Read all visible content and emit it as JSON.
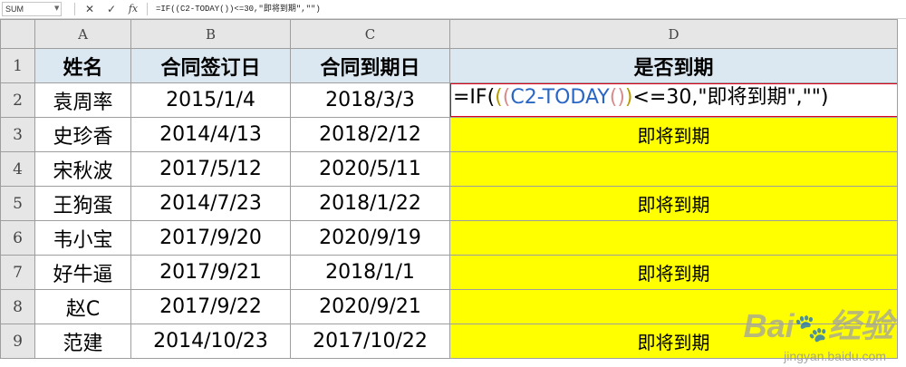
{
  "formula_bar": {
    "name_box": "SUM",
    "cancel_icon": "✕",
    "enter_icon": "✓",
    "fx_label": "fx",
    "formula": "=IF((C2-TODAY())<=30,\"即将到期\",\"\")"
  },
  "columns": [
    "A",
    "B",
    "C",
    "D"
  ],
  "rows": [
    "1",
    "2",
    "3",
    "4",
    "5",
    "6",
    "7",
    "8",
    "9"
  ],
  "headers": [
    "姓名",
    "合同签订日",
    "合同到期日",
    "是否到期"
  ],
  "data": [
    {
      "name": "袁周率",
      "sign": "2015/1/4",
      "due": "2018/3/3",
      "status": ""
    },
    {
      "name": "史珍香",
      "sign": "2014/4/13",
      "due": "2018/2/12",
      "status": "即将到期"
    },
    {
      "name": "宋秋波",
      "sign": "2017/5/12",
      "due": "2020/5/11",
      "status": ""
    },
    {
      "name": "王狗蛋",
      "sign": "2014/7/23",
      "due": "2018/1/22",
      "status": "即将到期"
    },
    {
      "name": "韦小宝",
      "sign": "2017/9/20",
      "due": "2020/9/19",
      "status": ""
    },
    {
      "name": "好牛逼",
      "sign": "2017/9/21",
      "due": "2018/1/1",
      "status": "即将到期"
    },
    {
      "name": "赵C",
      "sign": "2017/9/22",
      "due": "2020/9/21",
      "status": ""
    },
    {
      "name": "范建",
      "sign": "2014/10/23",
      "due": "2017/10/22",
      "status": "即将到期"
    }
  ],
  "edit_cell": {
    "p1": "=IF(",
    "paren_open_outer": "(",
    "paren_open_inner": "(",
    "ref": "C2-TODAY",
    "paren_close_inner": "()",
    "paren_close_outer": ")",
    "rest": "<=30,\"即将到期\",\"\")"
  },
  "watermark": {
    "logo": "Bai",
    "paw": "🐾",
    "brand": "经验",
    "url": "jingyan.baidu.com"
  },
  "colors": {
    "highlight": "#ffff00",
    "header_fill": "#dbe7f1",
    "edit_border": "#e3001b"
  }
}
